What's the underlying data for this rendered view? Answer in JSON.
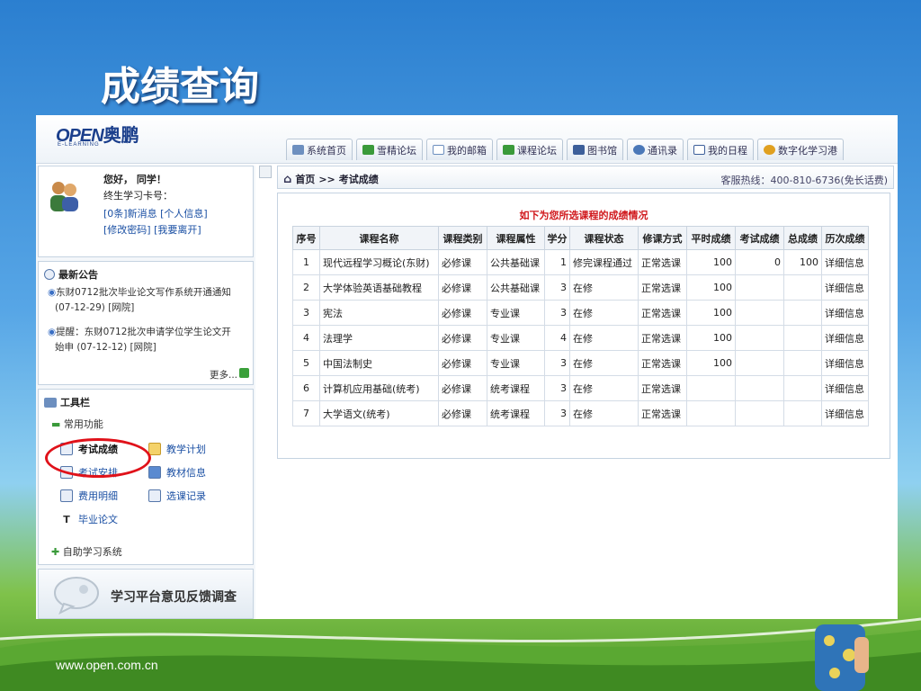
{
  "slide": {
    "title": "成绩查询",
    "footer_url": "www.open.com.cn"
  },
  "header": {
    "logo_open": "OPEN",
    "logo_cn": "奥鹏",
    "logo_sub": "E-LEARNING",
    "tabs": [
      {
        "label": "系统首页",
        "icon": "home-icon"
      },
      {
        "label": "雪精论坛",
        "icon": "forum-icon"
      },
      {
        "label": "我的邮箱",
        "icon": "mail-icon"
      },
      {
        "label": "课程论坛",
        "icon": "course-forum-icon"
      },
      {
        "label": "图书馆",
        "icon": "library-icon"
      },
      {
        "label": "通讯录",
        "icon": "contacts-icon"
      },
      {
        "label": "我的日程",
        "icon": "calendar-icon"
      },
      {
        "label": "数字化学习港",
        "icon": "digital-port-icon"
      }
    ]
  },
  "user": {
    "greeting": "您好，     同学！",
    "card_label": "终生学习卡号：",
    "new_msgs": "[0条]新消息",
    "personal_info": "[个人信息]",
    "change_pwd": "[修改密码]",
    "logout": "[我要离开]"
  },
  "notices": {
    "title": "最新公告",
    "items": [
      {
        "line1": "东财0712批次毕业论文写作系统开通通知",
        "line2": "(07-12-29) [网院]"
      },
      {
        "line1": "提醒：东财0712批次申请学位学生论文开",
        "line2": "始申  (07-12-12) [网院]"
      }
    ],
    "more": "更多..."
  },
  "toolbar": {
    "title": "工具栏",
    "common": "常用功能",
    "items": [
      {
        "label": "考试成绩",
        "icon": "exam-score-icon"
      },
      {
        "label": "教学计划",
        "icon": "teaching-plan-icon"
      },
      {
        "label": "考试安排",
        "icon": "exam-schedule-icon"
      },
      {
        "label": "教材信息",
        "icon": "textbook-icon"
      },
      {
        "label": "费用明细",
        "icon": "fee-icon"
      },
      {
        "label": "选课记录",
        "icon": "course-record-icon"
      },
      {
        "label": "毕业论文",
        "icon": "thesis-icon"
      }
    ],
    "self_study": "自助学习系统"
  },
  "feedback": {
    "label": "学习平台意见反馈调查"
  },
  "breadcrumb": {
    "home": "首页",
    "sep": ">>",
    "current": "考试成绩",
    "hotline": "客服热线：400-810-6736(免长话费)"
  },
  "grades": {
    "caption": "如下为您所选课程的成绩情况",
    "headers": [
      "序号",
      "课程名称",
      "课程类别",
      "课程属性",
      "学分",
      "课程状态",
      "修课方式",
      "平时成绩",
      "考试成绩",
      "总成绩",
      "历次成绩"
    ],
    "rows": [
      [
        "1",
        "现代远程学习概论(东财)",
        "必修课",
        "公共基础课",
        "1",
        "修完课程通过",
        "正常选课",
        "100",
        "0",
        "100",
        "详细信息"
      ],
      [
        "2",
        "大学体验英语基础教程",
        "必修课",
        "公共基础课",
        "3",
        "在修",
        "正常选课",
        "100",
        "",
        "",
        "详细信息"
      ],
      [
        "3",
        "宪法",
        "必修课",
        "专业课",
        "3",
        "在修",
        "正常选课",
        "100",
        "",
        "",
        "详细信息"
      ],
      [
        "4",
        "法理学",
        "必修课",
        "专业课",
        "4",
        "在修",
        "正常选课",
        "100",
        "",
        "",
        "详细信息"
      ],
      [
        "5",
        "中国法制史",
        "必修课",
        "专业课",
        "3",
        "在修",
        "正常选课",
        "100",
        "",
        "",
        "详细信息"
      ],
      [
        "6",
        "计算机应用基础(统考)",
        "必修课",
        "统考课程",
        "3",
        "在修",
        "正常选课",
        "",
        "",
        "",
        "详细信息"
      ],
      [
        "7",
        "大学语文(统考)",
        "必修课",
        "统考课程",
        "3",
        "在修",
        "正常选课",
        "",
        "",
        "",
        "详细信息"
      ]
    ]
  }
}
